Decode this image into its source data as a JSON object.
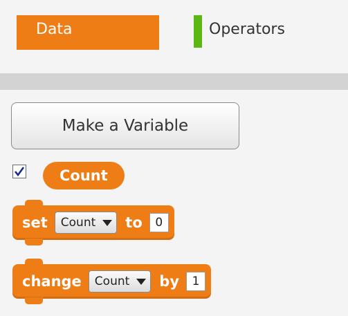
{
  "tabs": {
    "data_label": "Data",
    "operators_label": "Operators"
  },
  "colors": {
    "data_category": "#EE7D16",
    "operators_category": "#5CB712"
  },
  "make_variable_label": "Make a Variable",
  "variable": {
    "name": "Count",
    "checked": true
  },
  "set_block": {
    "word_set": "set",
    "variable": "Count",
    "word_to": "to",
    "value": "0"
  },
  "change_block": {
    "word_change": "change",
    "variable": "Count",
    "word_by": "by",
    "value": "1"
  }
}
